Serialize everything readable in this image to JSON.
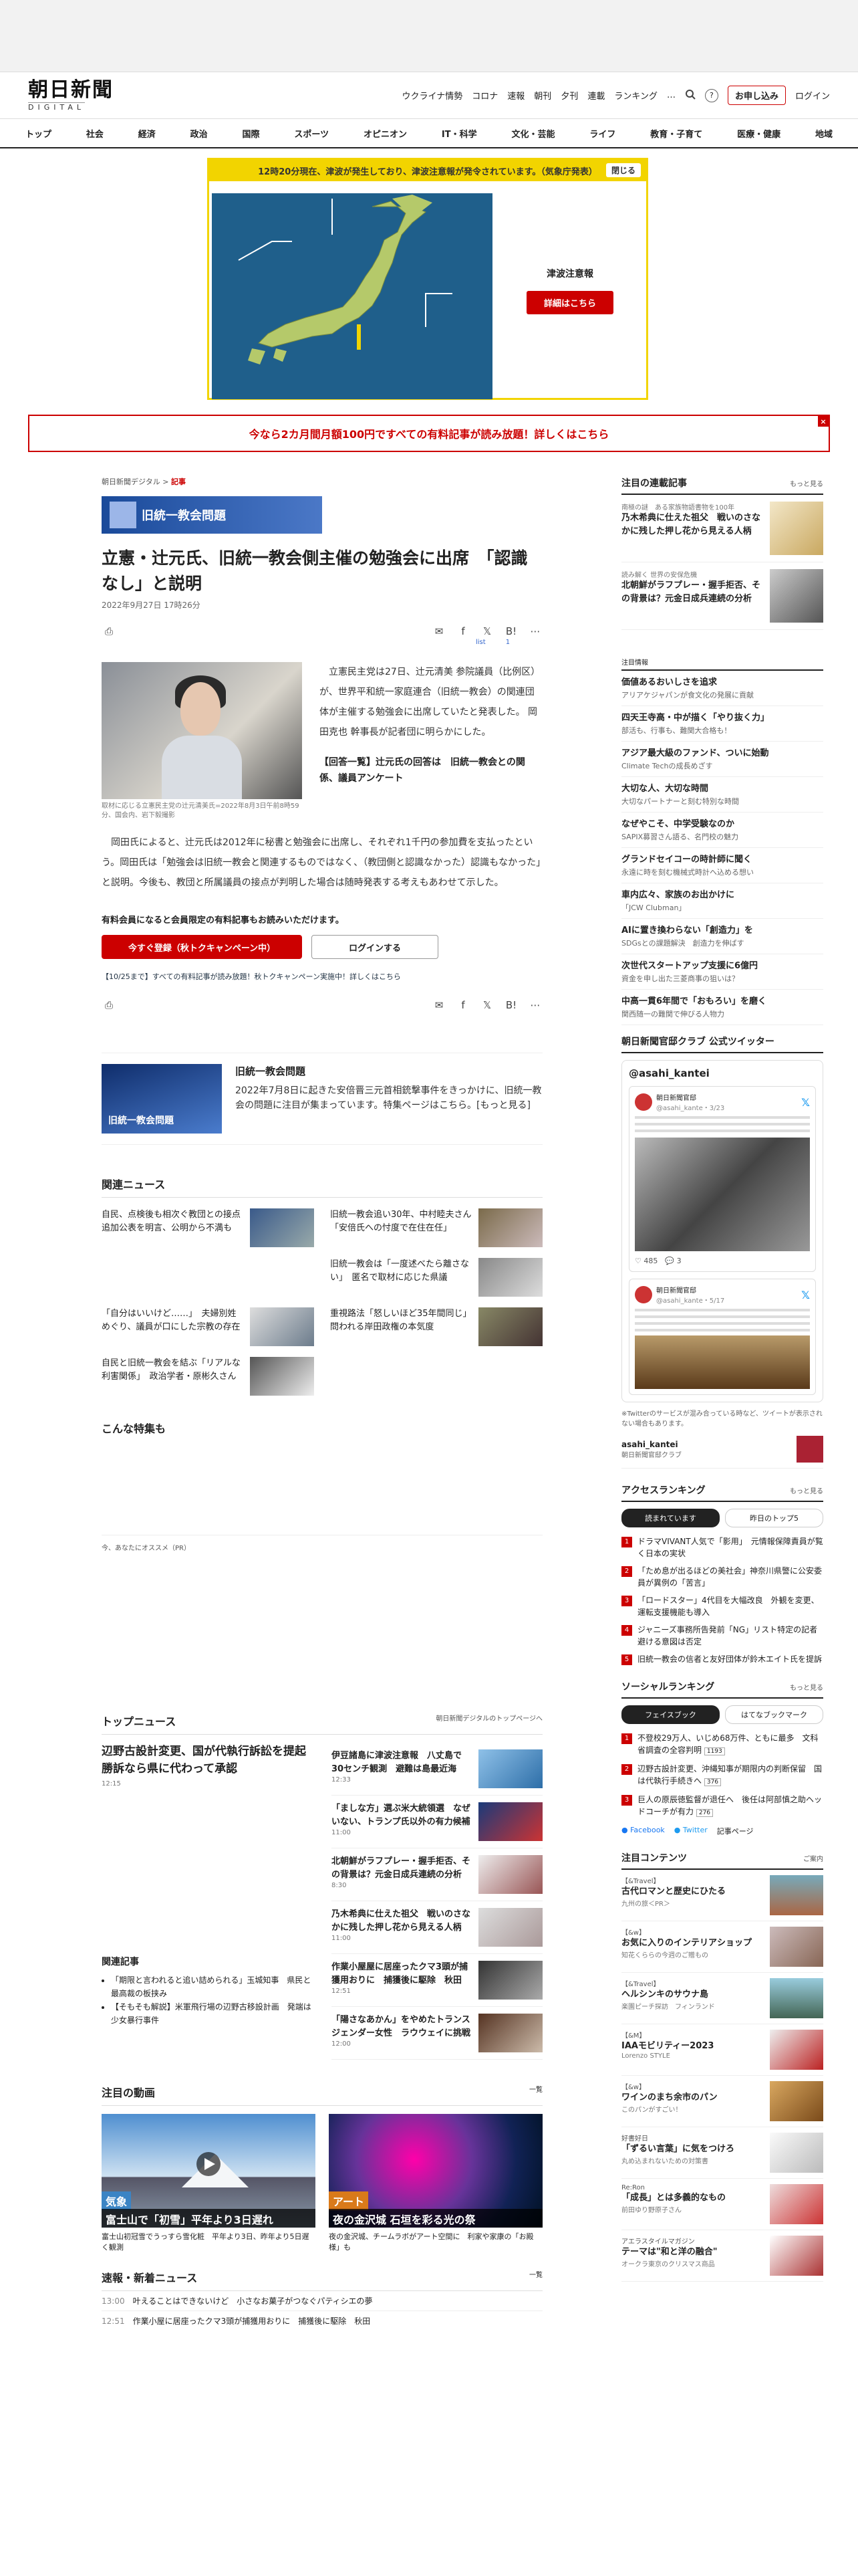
{
  "header": {
    "logo_jp": "朝日新聞",
    "logo_en": "DIGITAL",
    "links": [
      "ウクライナ情勢",
      "コロナ",
      "速報",
      "朝刊",
      "夕刊",
      "連載",
      "ランキング"
    ],
    "more_icon": "…",
    "help_icon": "?",
    "subscribe": "お申し込み",
    "login": "ログイン"
  },
  "main_nav": [
    "トップ",
    "社会",
    "経済",
    "政治",
    "国際",
    "スポーツ",
    "オピニオン",
    "IT・科学",
    "文化・芸能",
    "ライフ",
    "教育・子育て",
    "医療・健康",
    "地域"
  ],
  "alert": {
    "header": "12時20分現在、津波が発生しており、津波注意報が発令されています。（気象庁発表）",
    "close": "閉じる",
    "title": "津波注意報",
    "button": "詳細はこちら"
  },
  "promo": {
    "text": "今なら2カ月間月額100円ですべての有料記事が読み放題！詳しくはこちら",
    "close": "×"
  },
  "article": {
    "breadcrumb_home": "朝日新聞デジタル",
    "breadcrumb_sep": ">",
    "breadcrumb_section": "記事",
    "banner": "旧統一教会問題",
    "title": "立憲・辻元氏、旧統一教会側主催の勉強会に出席　「認識なし」と説明",
    "date": "2022年9月27日 17時26分",
    "list_label": "list",
    "comment_count": "1",
    "paragraph1": "　立憲民主党は27日、辻元清美 参院議員（比例区）が、世界平和統一家庭連合（旧統一教会）の関連団体が主催する勉強会に出席していたと発表した。 岡田克也 幹事長が記者団に明らかにした。",
    "inline_link": "【回答一覧】辻元氏の回答は　旧統一教会との関係、議員アンケート",
    "caption": "取材に応じる立憲民主党の辻元清美氏=2022年8月3日午前8時59分、国会内、岩下毅撮影",
    "paragraph2": "　岡田氏によると、辻元氏は2012年に秘書と勉強会に出席し、それぞれ1千円の参加費を支払ったという。岡田氏は「勉強会は旧統一教会と関連するものではなく、（教団側と認識なかった）認識もなかった」と説明。今後も、教団と所属議員の接点が判明した場合は随時発表する考えもあわせて示した。",
    "paywall_text": "有料会員になると会員限定の有料記事もお読みいただけます。",
    "register_btn": "今すぐ登録（秋トクキャンペーン中）",
    "login_btn": "ログインする",
    "campaign": "【10/25まで】すべての有料記事が読み放題！秋トクキャンペーン実施中！詳しくはこちら"
  },
  "topic": {
    "banner": "旧統一教会問題",
    "title": "旧統一教会問題",
    "desc": "2022年7月8日に起きた安倍晋三元首相銃撃事件をきっかけに、旧統一教会の問題に注目が集まっています。特集ページはこちら。[もっと見る]"
  },
  "related": {
    "heading": "関連ニュース",
    "items": [
      "自民、点検後も相次ぐ教団との接点　追加公表を明言、公明から不満も",
      "旧統一教会追い30年、中村睦夫さん「安倍氏への忖度で在住在任」",
      "旧統一教会は「一度述べたら離さない」　匿名で取材に応じた県議",
      "「自分はいいけど……」　夫婦別姓めぐり、議員が口にした宗教の存在",
      "重視路法「怒しいほど35年間同じ」　問われる岸田政権の本気度",
      "自民と旧統一教会を結ぶ「リアルな利害関係」　政治学者・原彬久さん"
    ]
  },
  "special": {
    "heading": "こんな特集も"
  },
  "recommend": {
    "heading": "今、あなたにオススメ（PR）"
  },
  "top_news": {
    "heading": "トップニュース",
    "link": "朝日新聞デジタルのトップページへ",
    "lead_title": "辺野古設計変更、国が代執行訴訟を提起　勝訴なら県に代わって承認",
    "lead_time": "12:15",
    "related_heading": "関連記事",
    "related": [
      "「期限と言われると追い詰められる」玉城知事　県民と最高裁の板挟み",
      "【そもそも解説】米軍飛行場の辺野古移設計画　発端は少女暴行事件"
    ],
    "items": [
      {
        "title": "伊豆諸島に津波注意報　八丈島で30センチ観測　避難は島最近海",
        "time": "12:33"
      },
      {
        "title": "「ましな方」選ぶ米大統領選　なぜいない、トランプ氏以外の有力候補",
        "time": "11:00"
      },
      {
        "title": "北朝鮮がラフプレー・握手拒否、その背景は？元金日成兵連続の分析",
        "time": "8:30"
      },
      {
        "title": "乃木希典に仕えた祖父　戦いのさなかに残した押し花から見える人柄",
        "time": "11:00"
      },
      {
        "title": "作業小屋屋に居座ったクマ3頭が捕獲用おりに　捕獲後に駆除　秋田",
        "time": "12:51"
      },
      {
        "title": "「陽さなあかん」をやめたトランスジェンダー女性　ラウウェイに挑戦",
        "time": "12:00"
      }
    ]
  },
  "videos": {
    "heading": "注目の動画",
    "more": "一覧",
    "items": [
      {
        "label": "気象",
        "caption": "富士山で「初雪」平年より3日遅れ",
        "desc": "富士山初冠雪でうっすら雪化粧　平年より3日、昨年より5日遅く観測"
      },
      {
        "label": "アート",
        "caption": "夜の金沢城 石垣を彩る光の祭",
        "desc": "夜の金沢城、チームラボがアート空間に　利家や家康の「お殿様」も"
      }
    ]
  },
  "breaking": {
    "heading": "速報・新着ニュース",
    "more": "一覧",
    "items": [
      {
        "time": "13:00",
        "title": "叶えることはできないけど　小さなお菓子がつなぐパティシエの夢"
      },
      {
        "time": "12:51",
        "title": "作業小屋に居座ったクマ3頭が捕獲用おりに　捕獲後に駆除　秋田"
      }
    ]
  },
  "sidebar": {
    "serial_heading": "注目の連載記事",
    "serial_more": "もっと見る",
    "serials": [
      {
        "meta": "南極の謎　ある家族物語書物を100年",
        "title": "乃木希典に仕えた祖父　戦いのさなかに残した押し花から見える人柄"
      },
      {
        "meta": "読み解く 世界の安保危機",
        "title": "北朝鮮がラフプレー・握手拒否、その背景は？元金日成兵連続の分析"
      }
    ],
    "attention_heading": "注目情報",
    "attention": [
      {
        "title": "価値あるおいしさを追求",
        "sub": "アリアケジャパンが食文化の発展に貢献"
      },
      {
        "title": "四天王寺高・中が描く「やり抜く力」",
        "sub": "部活も、行事も、難関大合格も！"
      },
      {
        "title": "アジア最大級のファンド、ついに始動",
        "sub": "Climate Techの成長めざす"
      },
      {
        "title": "大切な人、大切な時間",
        "sub": "大切なパートナーと刻む特別な時間"
      },
      {
        "title": "なぜやこそ、中学受験なのか",
        "sub": "SAPIX募習さん語る、名門校の魅力"
      },
      {
        "title": "グランドセイコーの時計師に聞く",
        "sub": "永遠に時を刻む機械式時計へ込める想い"
      },
      {
        "title": "車内広々、家族のお出かけに",
        "sub": "「JCW Clubman」"
      },
      {
        "title": "AIに置き換わらない「創造力」を",
        "sub": "SDGsとの課題解決　創造力を伸ばす"
      },
      {
        "title": "次世代スタートアップ支援に6億円",
        "sub": "資金を申し出た三菱商事の狙いは？"
      },
      {
        "title": "中高一貫6年間で「おもろい」を磨く",
        "sub": "関西随一の難関で伸びる人物力"
      }
    ],
    "twitter_heading": "朝日新聞官邸クラブ 公式ツイッター",
    "twitter_handle": "@asahi_kantei",
    "tweet_user": "朝日新聞官邸",
    "tweet1_handle": "@asahi_kante・3/23",
    "tweet2_handle": "@asahi_kante・5/17",
    "tweet_likes": "485",
    "tweet_replies": "3",
    "twitter_note": "※Twitterのサービスが混み合っている時など、ツイートが表示されない場合もあります。",
    "account_name": "asahi_kantei",
    "account_desc": "朝日新聞官邸クラブ",
    "access_heading": "アクセスランキング",
    "access_more": "もっと見る",
    "tabs": [
      "読まれています",
      "昨日のトップ5"
    ],
    "access": [
      "ドラマVIVANT人気で「影用」　元情報保障責員が覧く日本の実状",
      "「ため息が出るほどの美社会」神奈川県警に公安委員が異例の「苦言」",
      "「ロードスター」4代目を大幅改良　外観を変更、運転支援機能も導入",
      "ジャニーズ事務所告発前「NG」リスト特定の記者避ける意図は否定",
      "旧統一教会の信者と友好団体が鈴木エイト氏を提訴"
    ],
    "social_heading": "ソーシャルランキング",
    "social_more": "もっと見る",
    "social_tabs": [
      "フェイスブック",
      "はてなブックマーク"
    ],
    "social": [
      {
        "title": "不登校29万人、いじめ68万件、ともに最多　文科省調査の全容判明",
        "count": "1193"
      },
      {
        "title": "辺野古設計変更、沖縄知事が期限内の判断保留　国は代執行手続きへ",
        "count": "376"
      },
      {
        "title": "巨人の原辰徳監督が退任へ　後任は阿部慎之助ヘッドコーチが有力",
        "count": "276"
      }
    ],
    "share": [
      "Facebook",
      "Twitter",
      "記事ページ"
    ],
    "content_heading": "注目コンテンツ",
    "content_more": "ご案内",
    "contents": [
      {
        "lab": "【&Travel】",
        "title": "古代ロマンと歴史にひたる",
        "sub": "九州の旅＜PR＞"
      },
      {
        "lab": "【&w】",
        "title": "お気に入りのインテリアショップ",
        "sub": "知花くららの今週のご贈もの"
      },
      {
        "lab": "【&Travel】",
        "title": "ヘルシンキのサウナ島",
        "sub": "楽園ピーチ探訪　フィンランド"
      },
      {
        "lab": "【&M】",
        "title": "IAAモビリティー2023",
        "sub": "Lorenzo STYLE"
      },
      {
        "lab": "【&w】",
        "title": "ワインのまち余市のパン",
        "sub": "このパンがすごい！"
      },
      {
        "lab": "好書好日",
        "title": "「ずるい言葉」に気をつけろ",
        "sub": "丸め込まれないための対策書"
      },
      {
        "lab": "Re:Ron",
        "title": "「成長」とは多義的なもの",
        "sub": "前田ゆり野原子さん"
      },
      {
        "lab": "アエラスタイルマガジン",
        "title": "テーマは\"和と洋の融合\"",
        "sub": "オークラ東京のクリスマス商品"
      }
    ]
  },
  "colors": {
    "brand_red": "#cc0000",
    "alert_yellow": "#f2d400",
    "map_sea": "#1f5f8b",
    "topic_blue": "#1a4a9a"
  }
}
